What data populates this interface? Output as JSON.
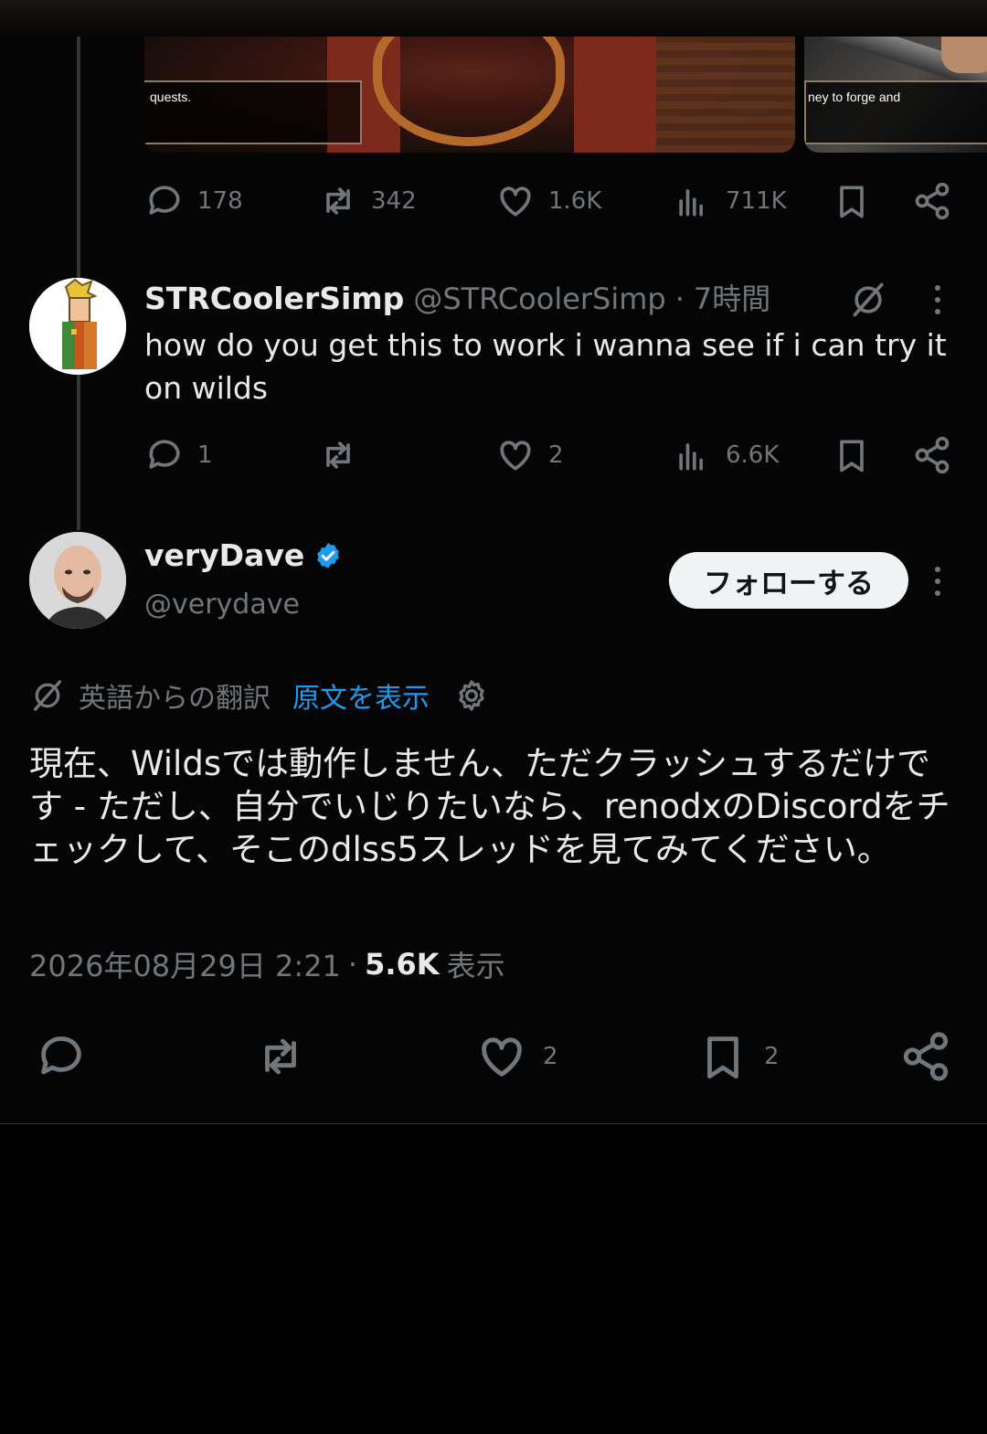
{
  "media": {
    "caption_1": "quests.",
    "caption_2": "ney to forge and"
  },
  "parent_tweet": {
    "stats": {
      "replies": "178",
      "reposts": "342",
      "likes": "1.6K",
      "views": "711K"
    }
  },
  "reply_tweet": {
    "display_name": "STRCoolerSimp",
    "handle": "@STRCoolerSimp",
    "separator": "·",
    "time": "7時間",
    "text": "how do you get this to work i wanna see if i can try it on wilds",
    "stats": {
      "replies": "1",
      "reposts": "",
      "likes": "2",
      "views": "6.6K"
    }
  },
  "main_tweet": {
    "display_name": "veryDave",
    "handle": "@verydave",
    "verified": true,
    "follow_label": "フォローする",
    "translation": {
      "label": "英語からの翻訳",
      "show_original": "原文を表示"
    },
    "text": "現在、Wildsでは動作しません、ただクラッシュするだけです - ただし、自分でいじりたいなら、renodxのDiscordをチェックして、そこのdlss5スレッドを見てみてください。",
    "timestamp": "2026年08月29日 2:21",
    "meta_separator": "·",
    "views_count": "5.6K",
    "views_label": "表示",
    "stats": {
      "replies": "",
      "reposts": "",
      "likes": "2",
      "bookmarks": "2"
    }
  },
  "colors": {
    "background": "#050505",
    "text_primary": "#e7e9ea",
    "text_secondary": "#71767b",
    "link_blue": "#1d9bf0",
    "verified_blue": "#1d9bf0"
  }
}
